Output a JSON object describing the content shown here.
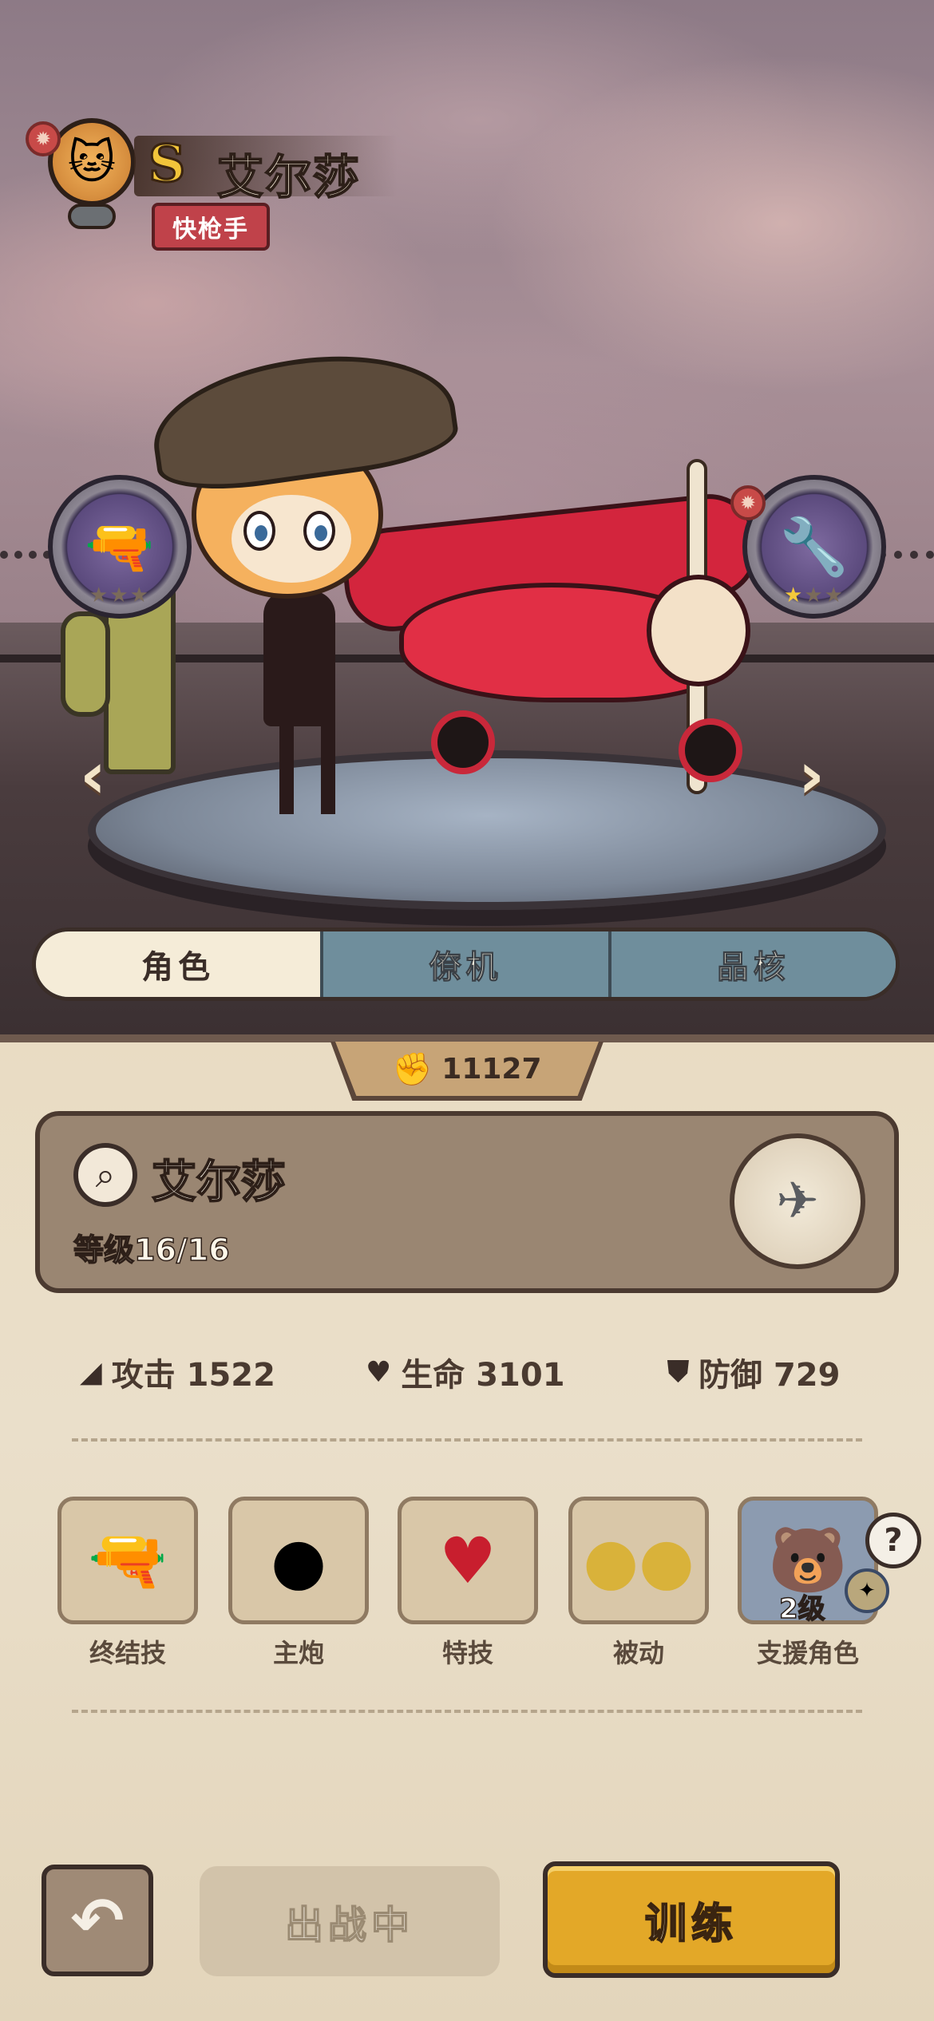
{
  "character": {
    "rank": "S",
    "name": "艾尔莎",
    "role": "快枪手",
    "level_text": "等级16/16"
  },
  "weapons": {
    "left": {
      "icon": "gold-ring-gun-icon",
      "stars": "★★★",
      "stars_active": 0
    },
    "right": {
      "icon": "blaster-icon",
      "stars": "★★★",
      "stars_active": 1
    }
  },
  "tabs": [
    {
      "label": "角色",
      "active": true
    },
    {
      "label": "僚机",
      "active": false
    },
    {
      "label": "晶核",
      "active": false
    }
  ],
  "power": {
    "value": "11127",
    "icon": "fist-icon"
  },
  "stats": {
    "attack": "攻击 1522",
    "health": "生命 3101",
    "defense": "防御 729"
  },
  "skills": [
    {
      "label": "终结技",
      "icon": "gatling-gun-icon"
    },
    {
      "label": "主炮",
      "icon": "bullet-icon"
    },
    {
      "label": "特技",
      "icon": "heart-gem-icon"
    },
    {
      "label": "被动",
      "icon": "double-bullet-icon"
    },
    {
      "label": "支援角色",
      "icon": "support-character-icon",
      "level": "2级"
    }
  ],
  "help": "?",
  "buttons": {
    "back": "↶",
    "deployed": "出战中",
    "train": "训练"
  },
  "colors": {
    "accent_gold": "#e3a828",
    "role_red": "#c0424a",
    "tab_inactive": "#6f8e9c",
    "panel_bg": "#e9dcc3"
  }
}
